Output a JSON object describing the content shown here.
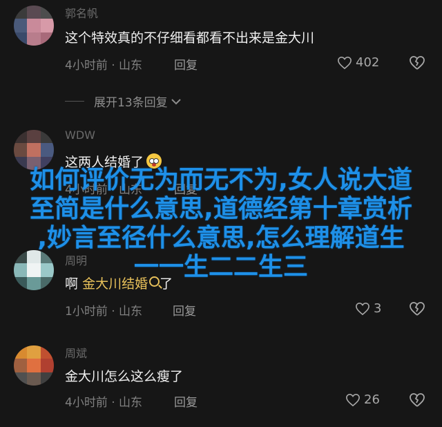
{
  "comments": [
    {
      "username": "郭名帆",
      "text": "这个特效真的不仔细看都看不出来是金大川",
      "time": "4小时前",
      "location": "山东",
      "reply": "回复",
      "likes": "402"
    },
    {
      "username": "WDW",
      "text": "这两人结婚了",
      "time": "4小时前",
      "location": "山东",
      "reply": "回复",
      "likes": ""
    },
    {
      "username": "周明",
      "text_prefix": "啊",
      "text_link": "金大川结婚",
      "text_suffix": "了",
      "time": "1小时前",
      "location": "山东",
      "reply": "回复",
      "likes": "3"
    },
    {
      "username": "周斌",
      "text": "金大川怎么这么瘦了",
      "time": "4小时前",
      "location": "山东",
      "reply": "回复",
      "likes": "26"
    }
  ],
  "expand_replies": "展开13条回复",
  "overlay_title": [
    "如何评价无为而无不为,女人说大道",
    "至简是什么意思,道德经第十章赏析",
    ",妙言至径什么意思,怎么理解道生",
    "一一生二二生三"
  ],
  "colors": {
    "background": "#161616",
    "overlay_text": "#1e90e8",
    "link": "#e8c15a"
  },
  "icons": {
    "like": "heart-icon",
    "dislike": "broken-heart-icon",
    "expand": "chevron-down-icon",
    "emoji": "emoji-icon",
    "search": "search-icon"
  }
}
